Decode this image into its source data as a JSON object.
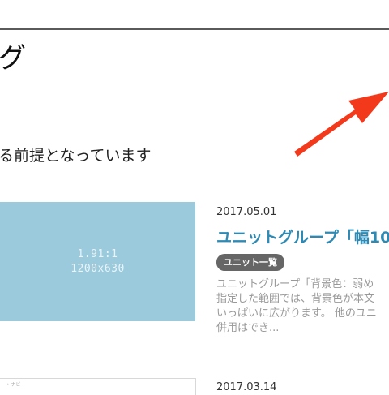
{
  "page": {
    "heading_fragment": "グ",
    "subtitle_fragment": "る前提となっています"
  },
  "cards": [
    {
      "image_label_ratio": "1.91:1",
      "image_label_size": "1200x630",
      "date": "2017.05.01",
      "title": "ユニットグループ「幅10",
      "tag": "ユニット一覧",
      "excerpt_lines": [
        "ユニットグループ「背景色：弱め",
        "指定した範囲では、背景色が本文",
        "いっぱいに広がります。 他のユニ",
        "併用はでき..."
      ]
    },
    {
      "image_text": "• ナビ",
      "date": "2017.03.14"
    }
  ],
  "colors": {
    "arrow": "#f2391c",
    "image_placeholder": "#9ccadd",
    "title_link": "#2f8ab3",
    "tag_bg": "#666666"
  }
}
